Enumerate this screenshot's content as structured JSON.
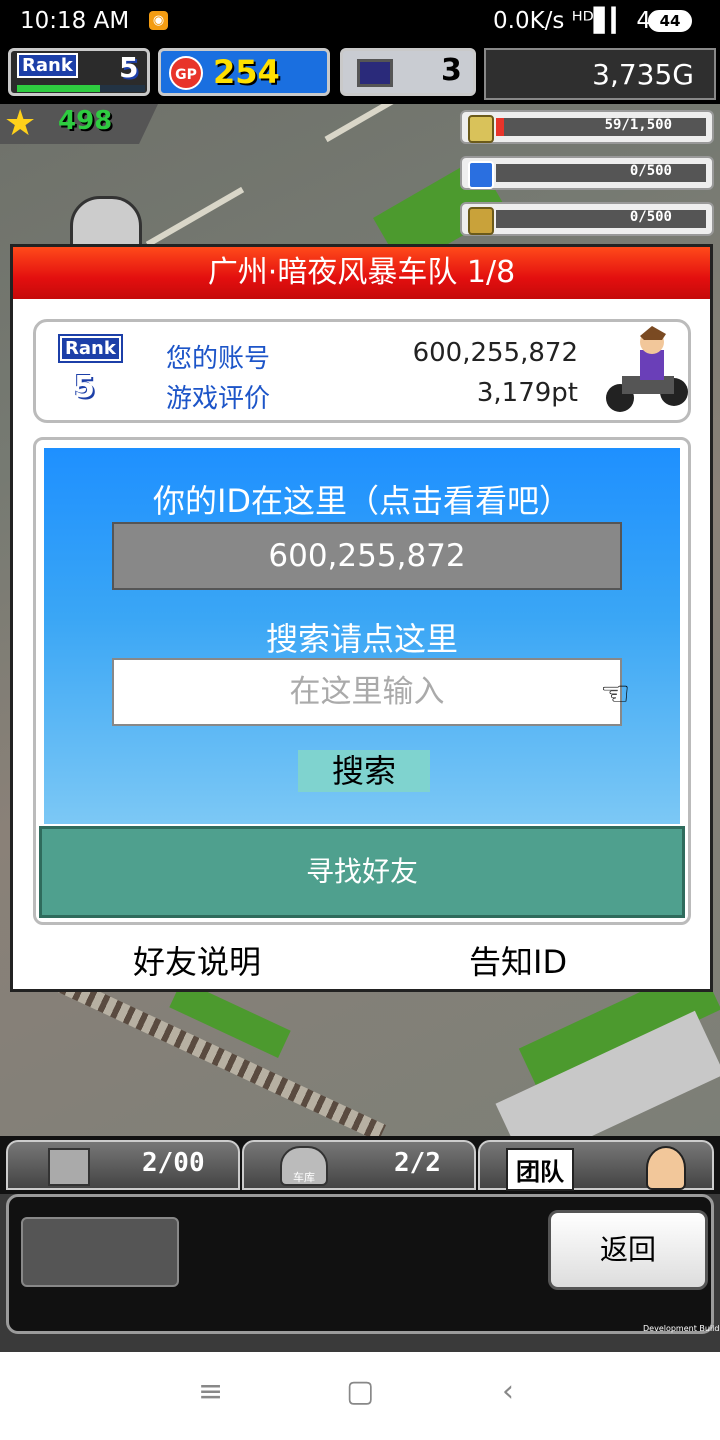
{
  "status_bar": {
    "time": "10:18 AM",
    "network": "0.0K/s ᴴᴰ▋▎ 4G",
    "battery": "44"
  },
  "hud": {
    "rank_label": "Rank",
    "rank_value": "5",
    "rank_progress": 0.65,
    "gp_badge": "GP",
    "gp_value": "254",
    "computer_value": "3",
    "gold_value": "3,735G",
    "star_value": "498",
    "resources": [
      {
        "icon": "coin-stack-icon",
        "text": "59/1,500",
        "fill": 0.04
      },
      {
        "icon": "bottle-icon",
        "text": "0/500",
        "fill": 0
      },
      {
        "icon": "wheat-icon",
        "text": "0/500",
        "fill": 0
      }
    ]
  },
  "dialog": {
    "title": "广州·暗夜风暴车队 1/8",
    "info": {
      "rank_label": "Rank",
      "rank_value": "5",
      "account_label": "您的账号",
      "account_value": "600,255,872",
      "rating_label": "游戏评价",
      "rating_value": "3,179pt"
    },
    "search": {
      "id_heading": "你的ID在这里（点击看看吧）",
      "id_value": "600,255,872",
      "search_heading": "搜索请点这里",
      "input_placeholder": "在这里输入",
      "search_button": "搜索",
      "find_friend_button": "寻找好友"
    },
    "friend_help_link": "好友说明",
    "share_id_link": "告知ID"
  },
  "bottom": {
    "tabs": [
      {
        "icon": "building-block-icon",
        "count": "2/00"
      },
      {
        "icon": "garage-car-icon",
        "label": "车库",
        "count": "2/2"
      },
      {
        "icon": "team-icon",
        "label": "团队"
      }
    ],
    "back_button": "返回",
    "dev_build": "Development Build"
  },
  "nav": {
    "menu": "≡",
    "home": "▢",
    "back": "‹"
  },
  "colors": {
    "title_red": "#e30f0f",
    "blue_panel": "#1e90ff",
    "find_friend_green": "#4fa08e",
    "search_button": "#7fd3cf",
    "label_blue": "#1d55c8"
  }
}
